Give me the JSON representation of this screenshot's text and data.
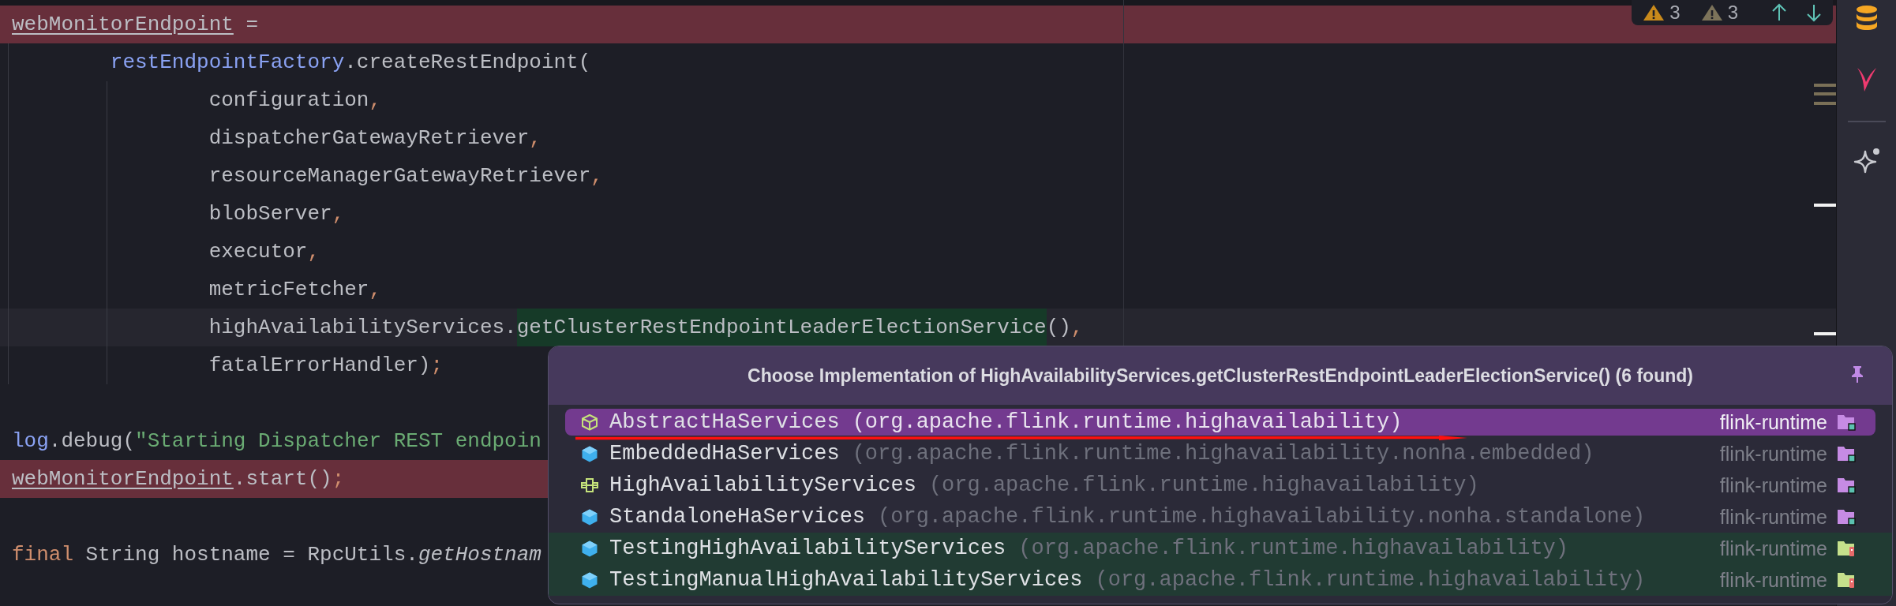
{
  "inspections": [
    {
      "kind": "warning",
      "count": "3"
    },
    {
      "kind": "weak_warning",
      "count": "3"
    }
  ],
  "editor": {
    "lines": [
      {
        "kind": "error",
        "segments": [
          {
            "text": "webMonitorEndpoint",
            "kind": "underlined"
          },
          {
            "text": " =",
            "kind": "plain"
          }
        ],
        "children": [
          {
            "kind": "normal",
            "segments": [
              {
                "text": "restEndpointFactory",
                "kind": "member"
              },
              {
                "text": ".createRestEndpoint(",
                "kind": "plain"
              }
            ],
            "children": [
              {
                "kind": "normal",
                "segments": [
                  {
                    "text": "configuration",
                    "kind": "plain"
                  },
                  {
                    "text": ",",
                    "kind": "punct"
                  }
                ]
              },
              {
                "kind": "normal",
                "segments": [
                  {
                    "text": "dispatcherGatewayRetriever",
                    "kind": "plain"
                  },
                  {
                    "text": ",",
                    "kind": "punct"
                  }
                ]
              },
              {
                "kind": "normal",
                "segments": [
                  {
                    "text": "resourceManagerGatewayRetriever",
                    "kind": "plain"
                  },
                  {
                    "text": ",",
                    "kind": "punct"
                  }
                ]
              },
              {
                "kind": "normal",
                "segments": [
                  {
                    "text": "blobServer",
                    "kind": "plain"
                  },
                  {
                    "text": ",",
                    "kind": "punct"
                  }
                ]
              },
              {
                "kind": "normal",
                "segments": [
                  {
                    "text": "executor",
                    "kind": "plain"
                  },
                  {
                    "text": ",",
                    "kind": "punct"
                  }
                ]
              },
              {
                "kind": "normal",
                "segments": [
                  {
                    "text": "metricFetcher",
                    "kind": "plain"
                  },
                  {
                    "text": ",",
                    "kind": "punct"
                  }
                ]
              },
              {
                "kind": "caret",
                "segments": [
                  {
                    "text": "highAvailabilityServices.",
                    "kind": "plain"
                  },
                  {
                    "text": "getClusterRestEndpointLeaderElectionService",
                    "kind": "usage"
                  },
                  {
                    "text": "()",
                    "kind": "plain"
                  },
                  {
                    "text": ",",
                    "kind": "punct"
                  }
                ]
              },
              {
                "kind": "normal",
                "segments": [
                  {
                    "text": "fatalErrorHandler)",
                    "kind": "plain"
                  },
                  {
                    "text": ";",
                    "kind": "punct"
                  }
                ]
              }
            ]
          }
        ]
      },
      {
        "kind": "blank"
      },
      {
        "kind": "normal",
        "segments": [
          {
            "text": "log",
            "kind": "member"
          },
          {
            "text": ".debug(",
            "kind": "plain"
          },
          {
            "text": "\"Starting Dispatcher REST endpoin",
            "kind": "string"
          }
        ]
      },
      {
        "kind": "error",
        "segments": [
          {
            "text": "webMonitorEndpoint",
            "kind": "underlined"
          },
          {
            "text": ".start()",
            "kind": "plain"
          },
          {
            "text": ";",
            "kind": "punct"
          }
        ]
      },
      {
        "kind": "blank"
      },
      {
        "kind": "normal",
        "segments": [
          {
            "text": "final",
            "kind": "keyword"
          },
          {
            "text": " String hostname = RpcUtils.",
            "kind": "plain"
          },
          {
            "text": "getHostnam",
            "kind": "static"
          }
        ]
      }
    ]
  },
  "popup": {
    "title": "Choose Implementation of HighAvailabilityServices.getClusterRestEndpointLeaderElectionService() (6 found)",
    "rows": [
      {
        "kind": "abstract",
        "name": "AbstractHaServices",
        "package": "(org.apache.flink.runtime.highavailability)",
        "module": "flink-runtime",
        "test": false,
        "selected": true
      },
      {
        "kind": "class",
        "name": "EmbeddedHaServices",
        "package": "(org.apache.flink.runtime.highavailability.nonha.embedded)",
        "module": "flink-runtime",
        "test": false,
        "selected": false
      },
      {
        "kind": "interface",
        "name": "HighAvailabilityServices",
        "package": "(org.apache.flink.runtime.highavailability)",
        "module": "flink-runtime",
        "test": false,
        "selected": false
      },
      {
        "kind": "class",
        "name": "StandaloneHaServices",
        "package": "(org.apache.flink.runtime.highavailability.nonha.standalone)",
        "module": "flink-runtime",
        "test": false,
        "selected": false
      },
      {
        "kind": "class",
        "name": "TestingHighAvailabilityServices",
        "package": "(org.apache.flink.runtime.highavailability)",
        "module": "flink-runtime",
        "test": true,
        "selected": false
      },
      {
        "kind": "class",
        "name": "TestingManualHighAvailabilityServices",
        "package": "(org.apache.flink.runtime.highavailability)",
        "module": "flink-runtime",
        "test": true,
        "selected": false
      }
    ]
  }
}
